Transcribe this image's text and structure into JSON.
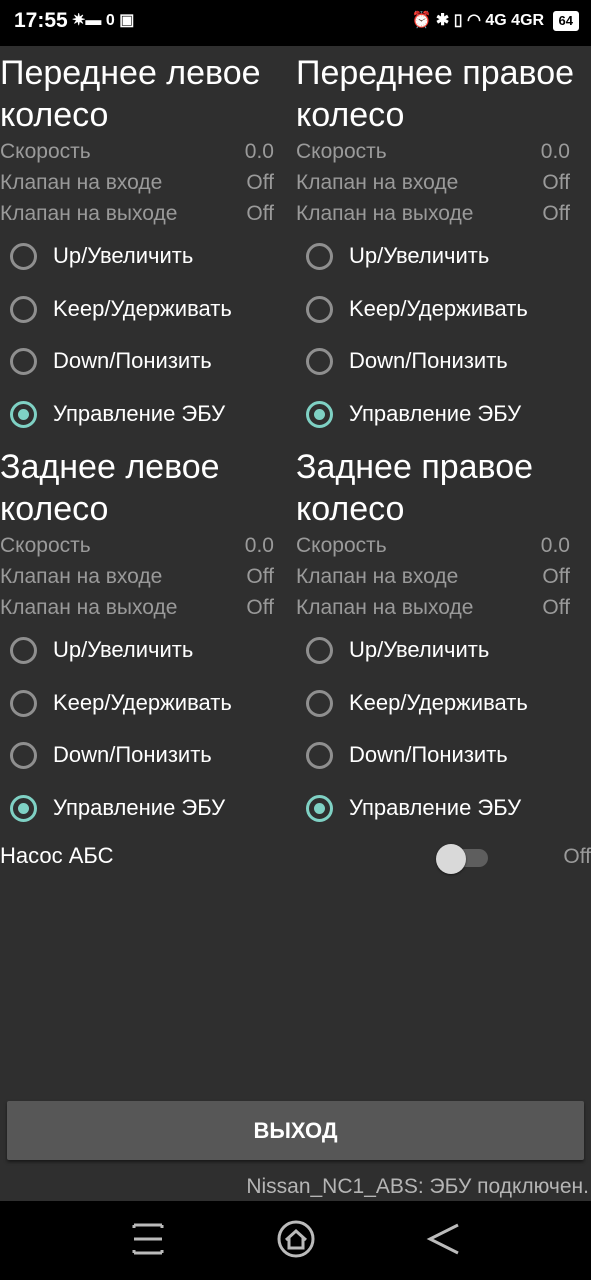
{
  "status_bar": {
    "time": "17:55",
    "left_icons": "✷▬ 0 ▣",
    "right_icons": "⏰ ✱ ▯ ◠ 4G 4GR",
    "battery": "64"
  },
  "wheels": [
    {
      "title_line1": "Переднее левое",
      "title_line2": "колесо",
      "speed_label": "Скорость",
      "speed_value": "0.0",
      "inlet_label": "Клапан на входе",
      "inlet_value": "Off",
      "outlet_label": "Клапан на выходе",
      "outlet_value": "Off",
      "options": [
        "Up/Увеличить",
        "Keep/Удерживать",
        "Down/Понизить",
        "Управление ЭБУ"
      ],
      "selected": 3
    },
    {
      "title_line1": "Переднее правое",
      "title_line2": "колесо",
      "speed_label": "Скорость",
      "speed_value": "0.0",
      "inlet_label": "Клапан на входе",
      "inlet_value": "Off",
      "outlet_label": "Клапан на выходе",
      "outlet_value": "Off",
      "options": [
        "Up/Увеличить",
        "Keep/Удерживать",
        "Down/Понизить",
        "Управление ЭБУ"
      ],
      "selected": 3
    },
    {
      "title_line1": "Заднее левое",
      "title_line2": "колесо",
      "speed_label": "Скорость",
      "speed_value": "0.0",
      "inlet_label": "Клапан на входе",
      "inlet_value": "Off",
      "outlet_label": "Клапан на выходе",
      "outlet_value": "Off",
      "options": [
        "Up/Увеличить",
        "Keep/Удерживать",
        "Down/Понизить",
        "Управление ЭБУ"
      ],
      "selected": 3
    },
    {
      "title_line1": "Заднее правое",
      "title_line2": "колесо",
      "speed_label": "Скорость",
      "speed_value": "0.0",
      "inlet_label": "Клапан на входе",
      "inlet_value": "Off",
      "outlet_label": "Клапан на выходе",
      "outlet_value": "Off",
      "options": [
        "Up/Увеличить",
        "Keep/Удерживать",
        "Down/Понизить",
        "Управление ЭБУ"
      ],
      "selected": 3
    }
  ],
  "pump": {
    "label": "Насос АБС",
    "value": "Off",
    "enabled": false
  },
  "exit_button": "ВЫХОД",
  "status_message": "Nissan_NC1_ABS: ЭБУ подключен.",
  "colors": {
    "accent": "#7fd1c4",
    "background": "#2f2f2f",
    "button": "#575757"
  },
  "nav_icons": [
    "menu-icon",
    "home-icon",
    "back-icon"
  ]
}
